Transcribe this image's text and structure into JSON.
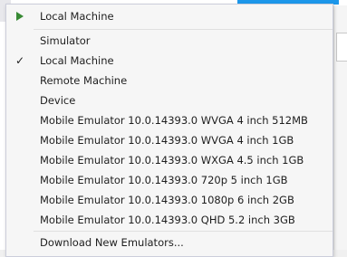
{
  "menu": {
    "header": {
      "label": "Local Machine",
      "icon": "play-icon",
      "icon_color": "#388a34"
    },
    "targets": [
      {
        "label": "Simulator",
        "checked": false
      },
      {
        "label": "Local Machine",
        "checked": true
      },
      {
        "label": "Remote Machine",
        "checked": false
      },
      {
        "label": "Device",
        "checked": false
      },
      {
        "label": "Mobile Emulator 10.0.14393.0 WVGA 4 inch 512MB",
        "checked": false
      },
      {
        "label": "Mobile Emulator 10.0.14393.0 WVGA 4 inch 1GB",
        "checked": false
      },
      {
        "label": "Mobile Emulator 10.0.14393.0 WXGA 4.5 inch 1GB",
        "checked": false
      },
      {
        "label": "Mobile Emulator 10.0.14393.0 720p 5 inch 1GB",
        "checked": false
      },
      {
        "label": "Mobile Emulator 10.0.14393.0 1080p 6 inch 2GB",
        "checked": false
      },
      {
        "label": "Mobile Emulator 10.0.14393.0 QHD 5.2 inch 3GB",
        "checked": false
      }
    ],
    "footer": {
      "label": "Download New Emulators..."
    },
    "check_glyph": "✓"
  },
  "accent_color": "#1c97ea"
}
